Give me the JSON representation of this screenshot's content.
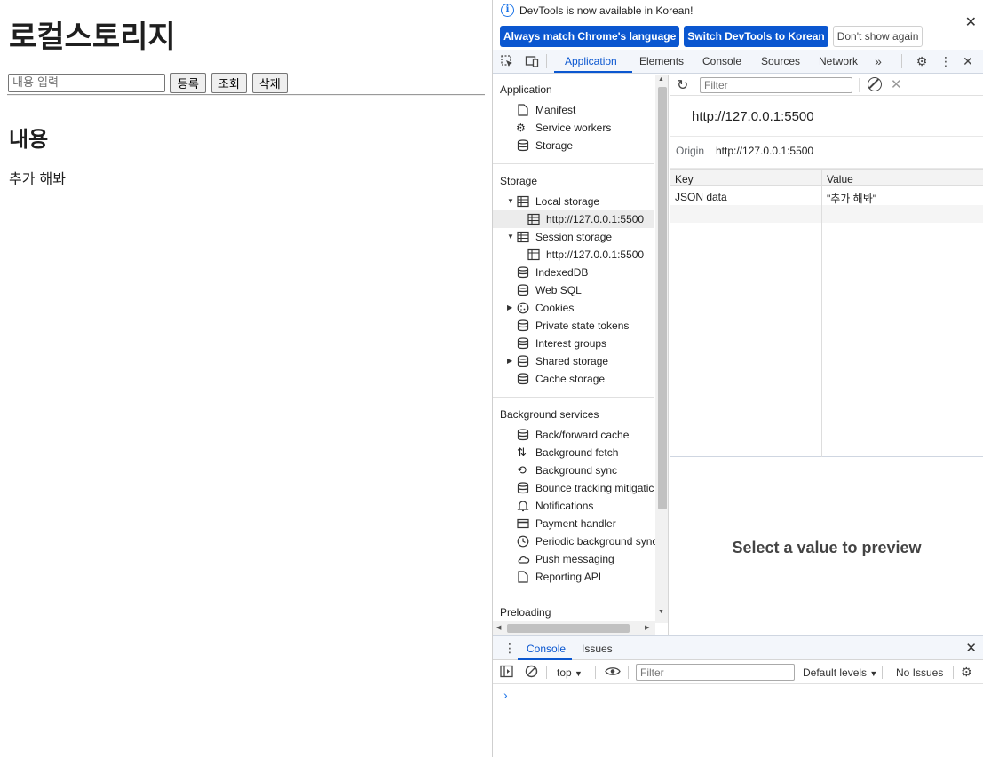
{
  "page": {
    "title": "로컬스토리지",
    "input_placeholder": "내용 입력",
    "buttons": {
      "register": "등록",
      "view": "조회",
      "delete": "삭제"
    },
    "section_heading": "내용",
    "content_text": "추가 해봐"
  },
  "devtools": {
    "infobar": {
      "message": "DevTools is now available in Korean!",
      "match_language": "Always match Chrome's language",
      "switch_korean": "Switch DevTools to Korean",
      "dont_show": "Don't show again"
    },
    "tabs": [
      "Application",
      "Elements",
      "Console",
      "Sources",
      "Network"
    ],
    "sidebar": {
      "application_header": "Application",
      "application_items": [
        "Manifest",
        "Service workers",
        "Storage"
      ],
      "storage_header": "Storage",
      "local_storage": "Local storage",
      "local_origin": "http://127.0.0.1:5500",
      "session_storage": "Session storage",
      "session_origin": "http://127.0.0.1:5500",
      "storage_items": [
        "IndexedDB",
        "Web SQL",
        "Cookies",
        "Private state tokens",
        "Interest groups",
        "Shared storage",
        "Cache storage"
      ],
      "background_header": "Background services",
      "background_items": [
        "Back/forward cache",
        "Background fetch",
        "Background sync",
        "Bounce tracking mitigatic",
        "Notifications",
        "Payment handler",
        "Periodic background sync",
        "Push messaging",
        "Reporting API"
      ],
      "preloading_header": "Preloading"
    },
    "storage_pane": {
      "filter_placeholder": "Filter",
      "origin_title": "http://127.0.0.1:5500",
      "origin_label": "Origin",
      "origin_value": "http://127.0.0.1:5500",
      "col_key": "Key",
      "col_value": "Value",
      "rows": [
        {
          "key": "JSON data",
          "value": "\"추가 해봐\""
        }
      ],
      "preview_message": "Select a value to preview"
    },
    "drawer": {
      "tab_console": "Console",
      "tab_issues": "Issues",
      "context": "top",
      "filter_placeholder": "Filter",
      "levels": "Default levels",
      "issues": "No Issues"
    }
  },
  "colors": {
    "accent": "#0b57d0",
    "info": "#1a73e8"
  }
}
